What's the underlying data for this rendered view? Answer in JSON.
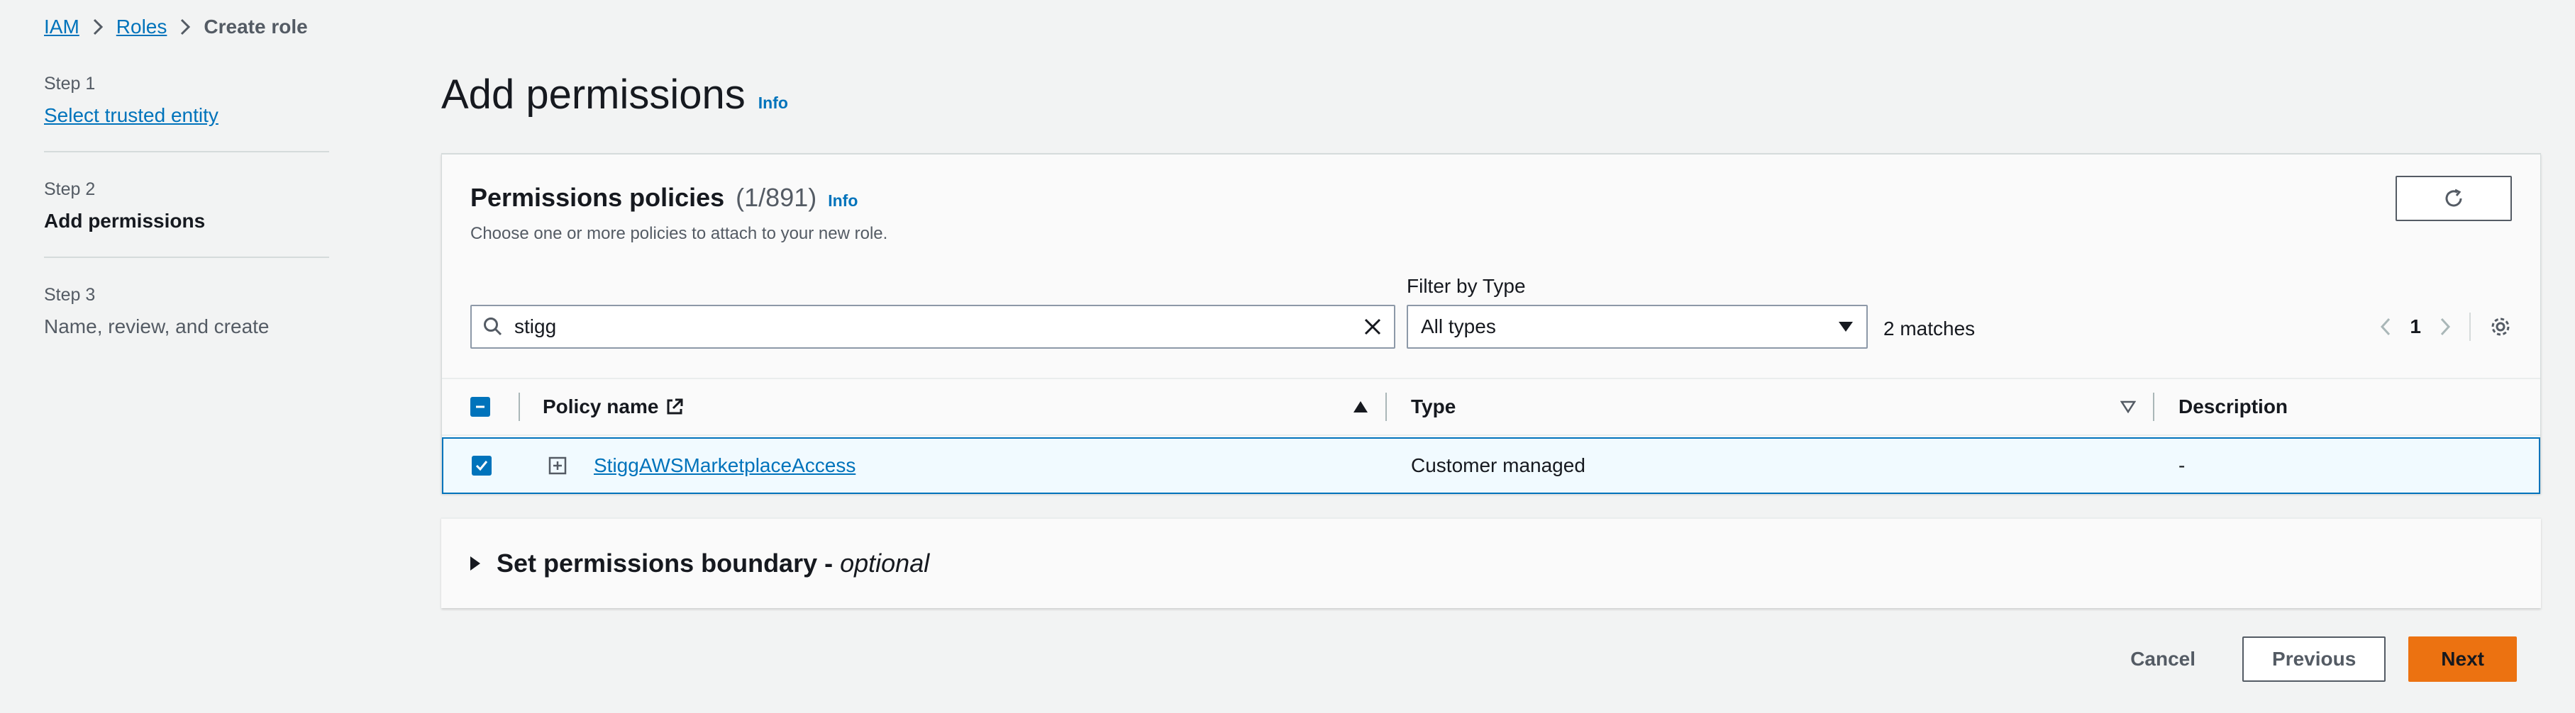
{
  "breadcrumb": {
    "items": [
      "IAM",
      "Roles"
    ],
    "current": "Create role"
  },
  "steps": [
    {
      "number": "Step 1",
      "title": "Select trusted entity"
    },
    {
      "number": "Step 2",
      "title": "Add permissions"
    },
    {
      "number": "Step 3",
      "title": "Name, review, and create"
    }
  ],
  "page": {
    "title": "Add permissions",
    "info": "Info"
  },
  "policies": {
    "title": "Permissions policies",
    "count": "(1/891)",
    "info": "Info",
    "description": "Choose one or more policies to attach to your new role.",
    "filter_label": "Filter by Type",
    "search_value": "stigg",
    "filter_value": "All types",
    "matches": "2 matches",
    "page_number": "1",
    "columns": [
      "Policy name",
      "Type",
      "Description"
    ],
    "rows": [
      {
        "name": "StiggAWSMarketplaceAccess",
        "type": "Customer managed",
        "description": "-",
        "selected": true
      }
    ]
  },
  "boundary": {
    "title": "Set permissions boundary - ",
    "optional": "optional"
  },
  "actions": {
    "cancel": "Cancel",
    "previous": "Previous",
    "next": "Next"
  },
  "colors": {
    "link": "#0073bb",
    "primary": "#ec7211",
    "background": "#f2f3f3",
    "selected_row": "#f1faff"
  }
}
